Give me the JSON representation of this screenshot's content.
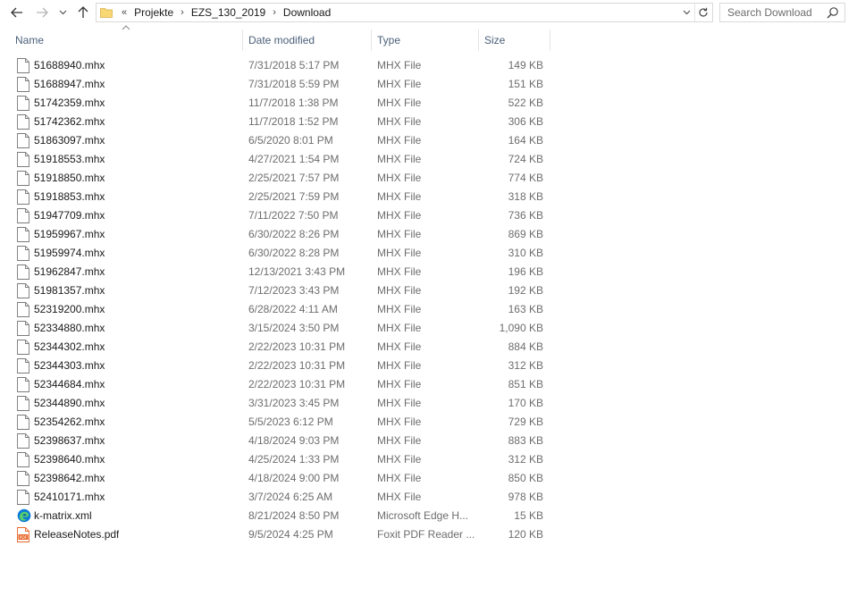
{
  "address": {
    "overflow_glyph": "«",
    "crumbs": [
      "Projekte",
      "EZS_130_2019",
      "Download"
    ]
  },
  "search": {
    "placeholder": "Search Download"
  },
  "columns": {
    "name": "Name",
    "date": "Date modified",
    "type": "Type",
    "size": "Size"
  },
  "files": [
    {
      "name": "51688940.mhx",
      "date": "7/31/2018 5:17 PM",
      "type": "MHX File",
      "size": "149 KB",
      "icon": "generic-file-icon"
    },
    {
      "name": "51688947.mhx",
      "date": "7/31/2018 5:59 PM",
      "type": "MHX File",
      "size": "151 KB",
      "icon": "generic-file-icon"
    },
    {
      "name": "51742359.mhx",
      "date": "11/7/2018 1:38 PM",
      "type": "MHX File",
      "size": "522 KB",
      "icon": "generic-file-icon"
    },
    {
      "name": "51742362.mhx",
      "date": "11/7/2018 1:52 PM",
      "type": "MHX File",
      "size": "306 KB",
      "icon": "generic-file-icon"
    },
    {
      "name": "51863097.mhx",
      "date": "6/5/2020 8:01 PM",
      "type": "MHX File",
      "size": "164 KB",
      "icon": "generic-file-icon"
    },
    {
      "name": "51918553.mhx",
      "date": "4/27/2021 1:54 PM",
      "type": "MHX File",
      "size": "724 KB",
      "icon": "generic-file-icon"
    },
    {
      "name": "51918850.mhx",
      "date": "2/25/2021 7:57 PM",
      "type": "MHX File",
      "size": "774 KB",
      "icon": "generic-file-icon"
    },
    {
      "name": "51918853.mhx",
      "date": "2/25/2021 7:59 PM",
      "type": "MHX File",
      "size": "318 KB",
      "icon": "generic-file-icon"
    },
    {
      "name": "51947709.mhx",
      "date": "7/11/2022 7:50 PM",
      "type": "MHX File",
      "size": "736 KB",
      "icon": "generic-file-icon"
    },
    {
      "name": "51959967.mhx",
      "date": "6/30/2022 8:26 PM",
      "type": "MHX File",
      "size": "869 KB",
      "icon": "generic-file-icon"
    },
    {
      "name": "51959974.mhx",
      "date": "6/30/2022 8:28 PM",
      "type": "MHX File",
      "size": "310 KB",
      "icon": "generic-file-icon"
    },
    {
      "name": "51962847.mhx",
      "date": "12/13/2021 3:43 PM",
      "type": "MHX File",
      "size": "196 KB",
      "icon": "generic-file-icon"
    },
    {
      "name": "51981357.mhx",
      "date": "7/12/2023 3:43 PM",
      "type": "MHX File",
      "size": "192 KB",
      "icon": "generic-file-icon"
    },
    {
      "name": "52319200.mhx",
      "date": "6/28/2022 4:11 AM",
      "type": "MHX File",
      "size": "163 KB",
      "icon": "generic-file-icon"
    },
    {
      "name": "52334880.mhx",
      "date": "3/15/2024 3:50 PM",
      "type": "MHX File",
      "size": "1,090 KB",
      "icon": "generic-file-icon"
    },
    {
      "name": "52344302.mhx",
      "date": "2/22/2023 10:31 PM",
      "type": "MHX File",
      "size": "884 KB",
      "icon": "generic-file-icon"
    },
    {
      "name": "52344303.mhx",
      "date": "2/22/2023 10:31 PM",
      "type": "MHX File",
      "size": "312 KB",
      "icon": "generic-file-icon"
    },
    {
      "name": "52344684.mhx",
      "date": "2/22/2023 10:31 PM",
      "type": "MHX File",
      "size": "851 KB",
      "icon": "generic-file-icon"
    },
    {
      "name": "52344890.mhx",
      "date": "3/31/2023 3:45 PM",
      "type": "MHX File",
      "size": "170 KB",
      "icon": "generic-file-icon"
    },
    {
      "name": "52354262.mhx",
      "date": "5/5/2023 6:12 PM",
      "type": "MHX File",
      "size": "729 KB",
      "icon": "generic-file-icon"
    },
    {
      "name": "52398637.mhx",
      "date": "4/18/2024 9:03 PM",
      "type": "MHX File",
      "size": "883 KB",
      "icon": "generic-file-icon"
    },
    {
      "name": "52398640.mhx",
      "date": "4/25/2024 1:33 PM",
      "type": "MHX File",
      "size": "312 KB",
      "icon": "generic-file-icon"
    },
    {
      "name": "52398642.mhx",
      "date": "4/18/2024 9:00 PM",
      "type": "MHX File",
      "size": "850 KB",
      "icon": "generic-file-icon"
    },
    {
      "name": "52410171.mhx",
      "date": "3/7/2024 6:25 AM",
      "type": "MHX File",
      "size": "978 KB",
      "icon": "generic-file-icon"
    },
    {
      "name": "k-matrix.xml",
      "date": "8/21/2024 8:50 PM",
      "type": "Microsoft Edge H...",
      "size": "15 KB",
      "icon": "edge-xml-icon"
    },
    {
      "name": "ReleaseNotes.pdf",
      "date": "9/5/2024 4:25 PM",
      "type": "Foxit PDF Reader ...",
      "size": "120 KB",
      "icon": "pdf-file-icon"
    }
  ],
  "colors": {
    "header_text": "#4c607a",
    "secondary_text": "#6d6d6d",
    "folder_yellow": "#f8d775",
    "edge_blue": "#0c7bd6",
    "pdf_orange": "#e8662a"
  }
}
